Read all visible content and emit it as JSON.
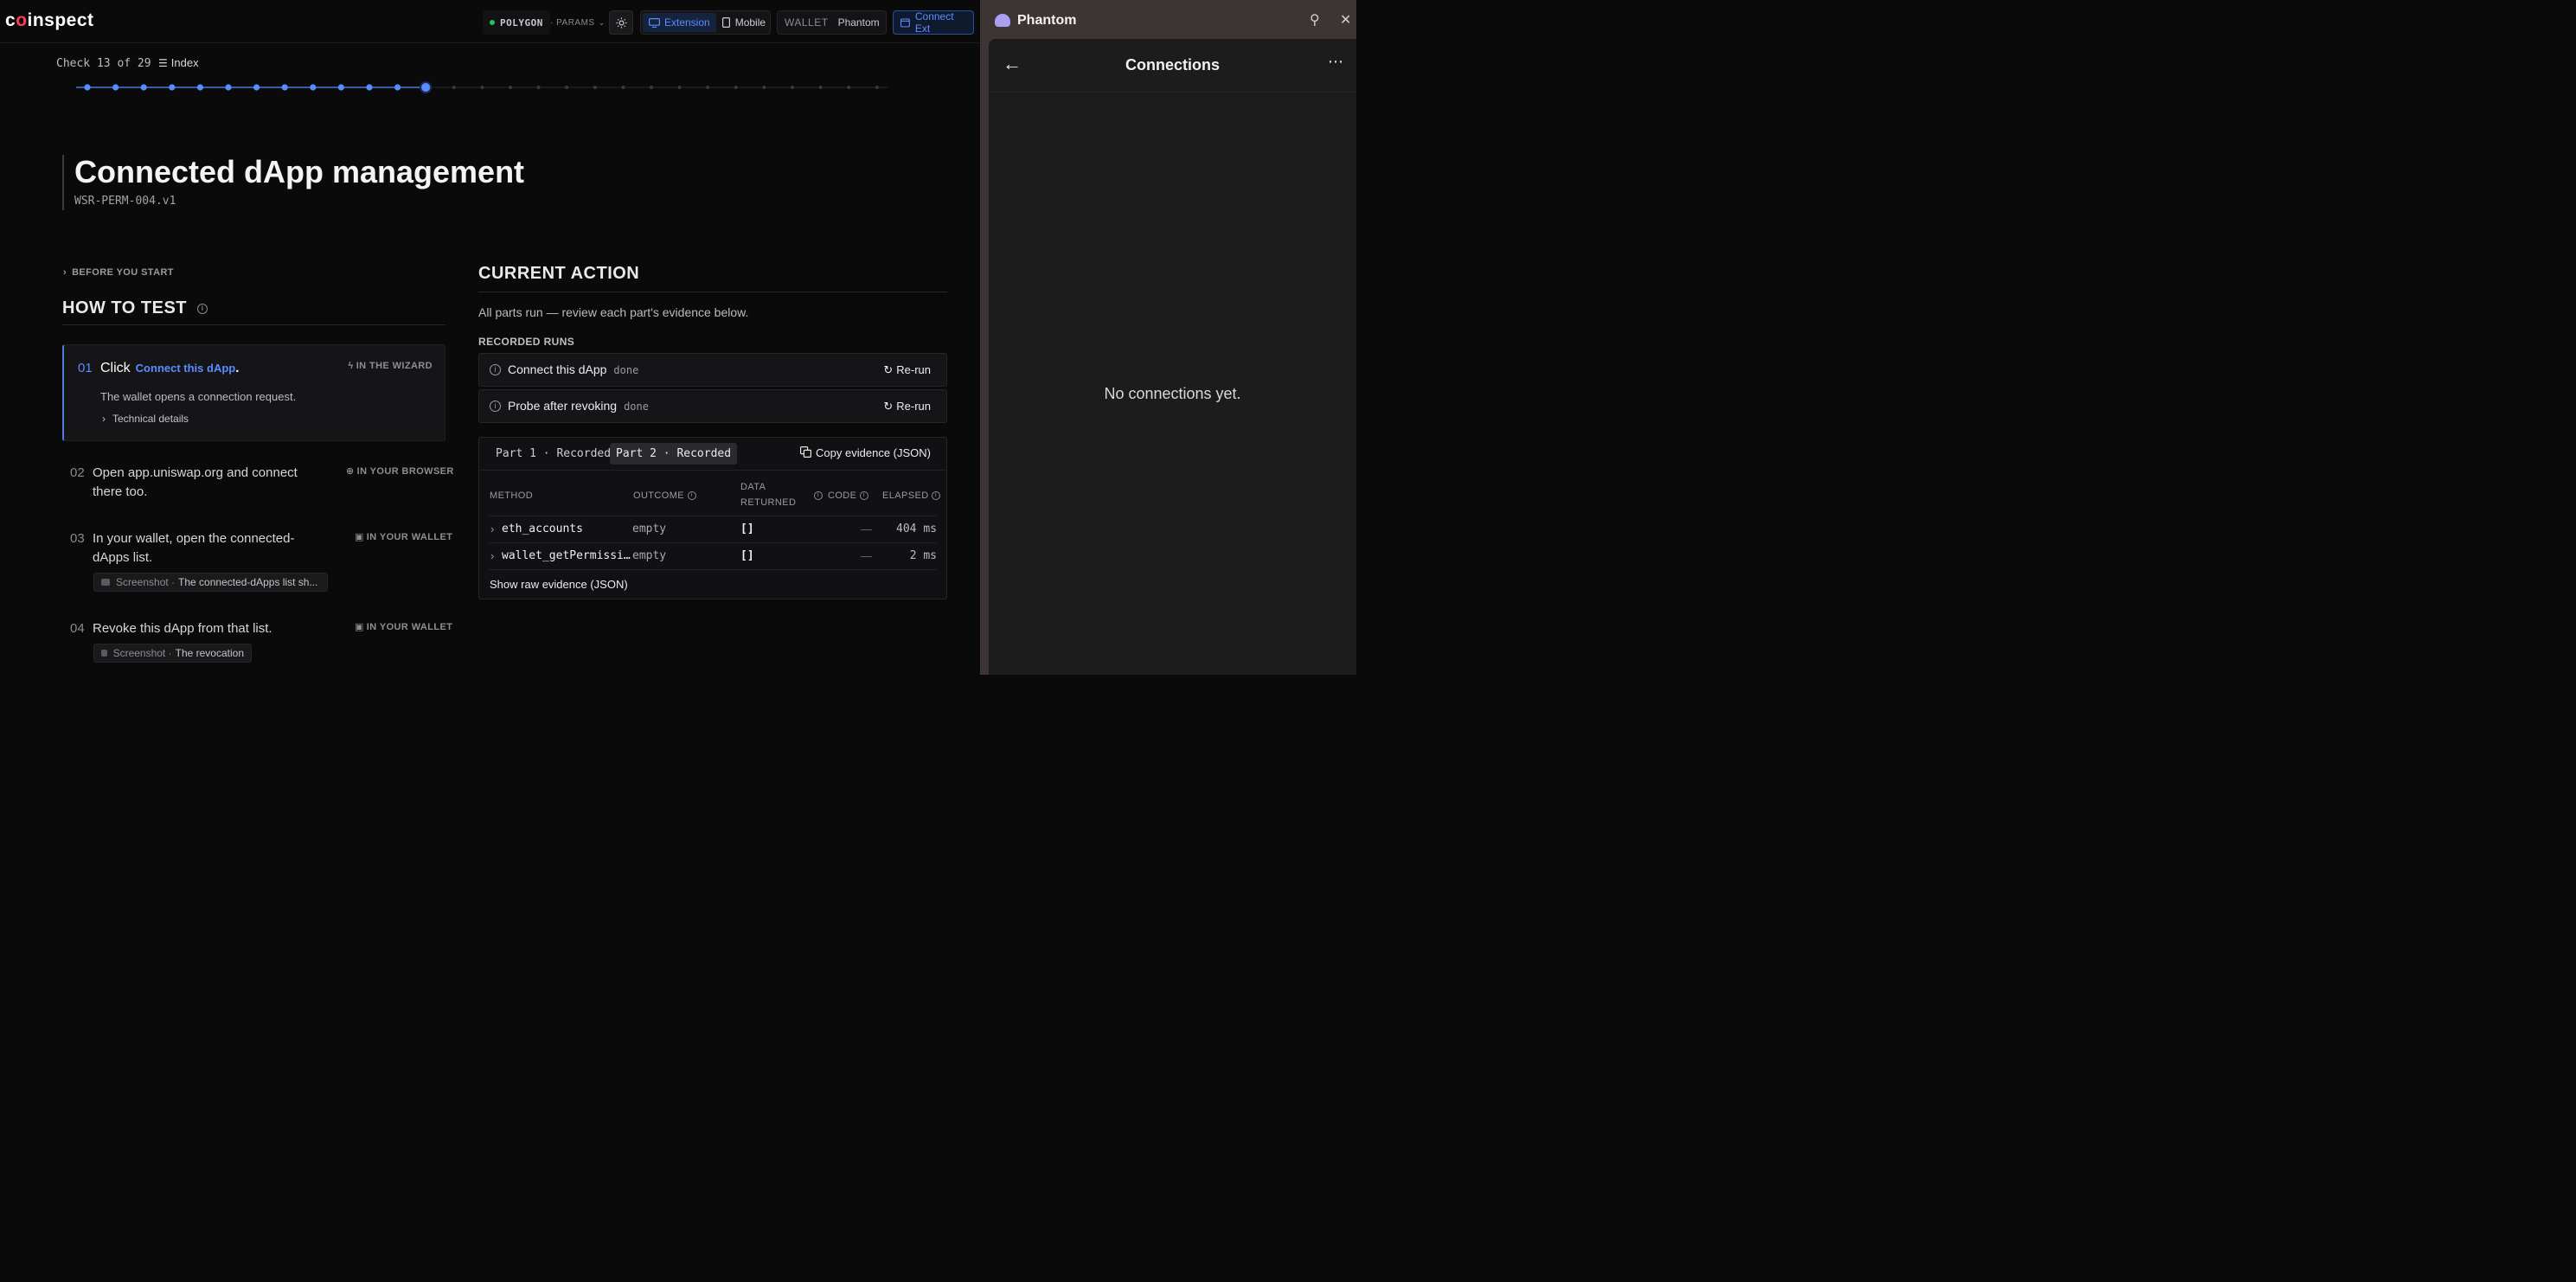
{
  "topbar": {
    "logo": "coinspect",
    "network": "POLYGON",
    "params": "· PARAMS",
    "view_tabs": [
      "Extension",
      "Mobile"
    ],
    "wallet_label": "WALLET",
    "wallet_name": "Phantom",
    "connect_ext": "Connect Ext"
  },
  "progress": {
    "check_text": "Check 13 of 29",
    "index_label": "Index",
    "current": 13,
    "total": 29,
    "done_color": "#5b8cff"
  },
  "test": {
    "title": "Connected dApp management",
    "id": "WSR-PERM-004.v1"
  },
  "how_to": {
    "before_label": "BEFORE YOU START",
    "heading": "HOW TO TEST",
    "steps": [
      {
        "num": "01",
        "text": "Click",
        "chip": "Connect this dApp",
        "trail": ".",
        "where": "IN THE WIZARD",
        "detail": "The wallet opens a connection request.",
        "tech": "Technical details"
      },
      {
        "num": "02",
        "text": "Open app.uniswap.org and connect there too.",
        "line1": "Open app.uniswap.org and connect",
        "line2": "there too.",
        "where": "IN YOUR BROWSER"
      },
      {
        "num": "03",
        "line1": "In your wallet, open the connected-",
        "line2": "dApps list.",
        "where": "IN YOUR WALLET",
        "shot_label": "Screenshot ·",
        "shot_caption": "The connected-dApps list sh..."
      },
      {
        "num": "04",
        "line1": "Revoke this dApp from that list.",
        "where": "IN YOUR WALLET",
        "shot_label": "Screenshot ·",
        "shot_caption": "The revocation"
      }
    ]
  },
  "current_action": {
    "heading": "CURRENT ACTION",
    "description": "All parts run — review each part's evidence below.",
    "recorded_label": "RECORDED RUNS",
    "runs": [
      {
        "name": "Connect this dApp",
        "status": "done",
        "action": "Re-run"
      },
      {
        "name": "Probe after revoking",
        "status": "done",
        "action": "Re-run"
      }
    ],
    "parts": [
      "Part 1 · Recorded",
      "Part 2 · Recorded"
    ],
    "copy_label": "Copy evidence (JSON)",
    "columns": {
      "method": "METHOD",
      "outcome": "OUTCOME",
      "data1": "DATA",
      "data2": "RETURNED",
      "code": "CODE",
      "elapsed": "ELAPSED"
    },
    "rows": [
      {
        "method": "eth_accounts",
        "outcome": "empty",
        "data": "[]",
        "code": "—",
        "elapsed": "404 ms"
      },
      {
        "method": "wallet_getPermissi…",
        "outcome": "empty",
        "data": "[]",
        "code": "—",
        "elapsed": "2 ms"
      }
    ],
    "raw_label": "Show raw evidence (JSON)"
  },
  "phantom": {
    "app_title": "Phantom",
    "screen_title": "Connections",
    "empty_text": "No connections yet."
  }
}
